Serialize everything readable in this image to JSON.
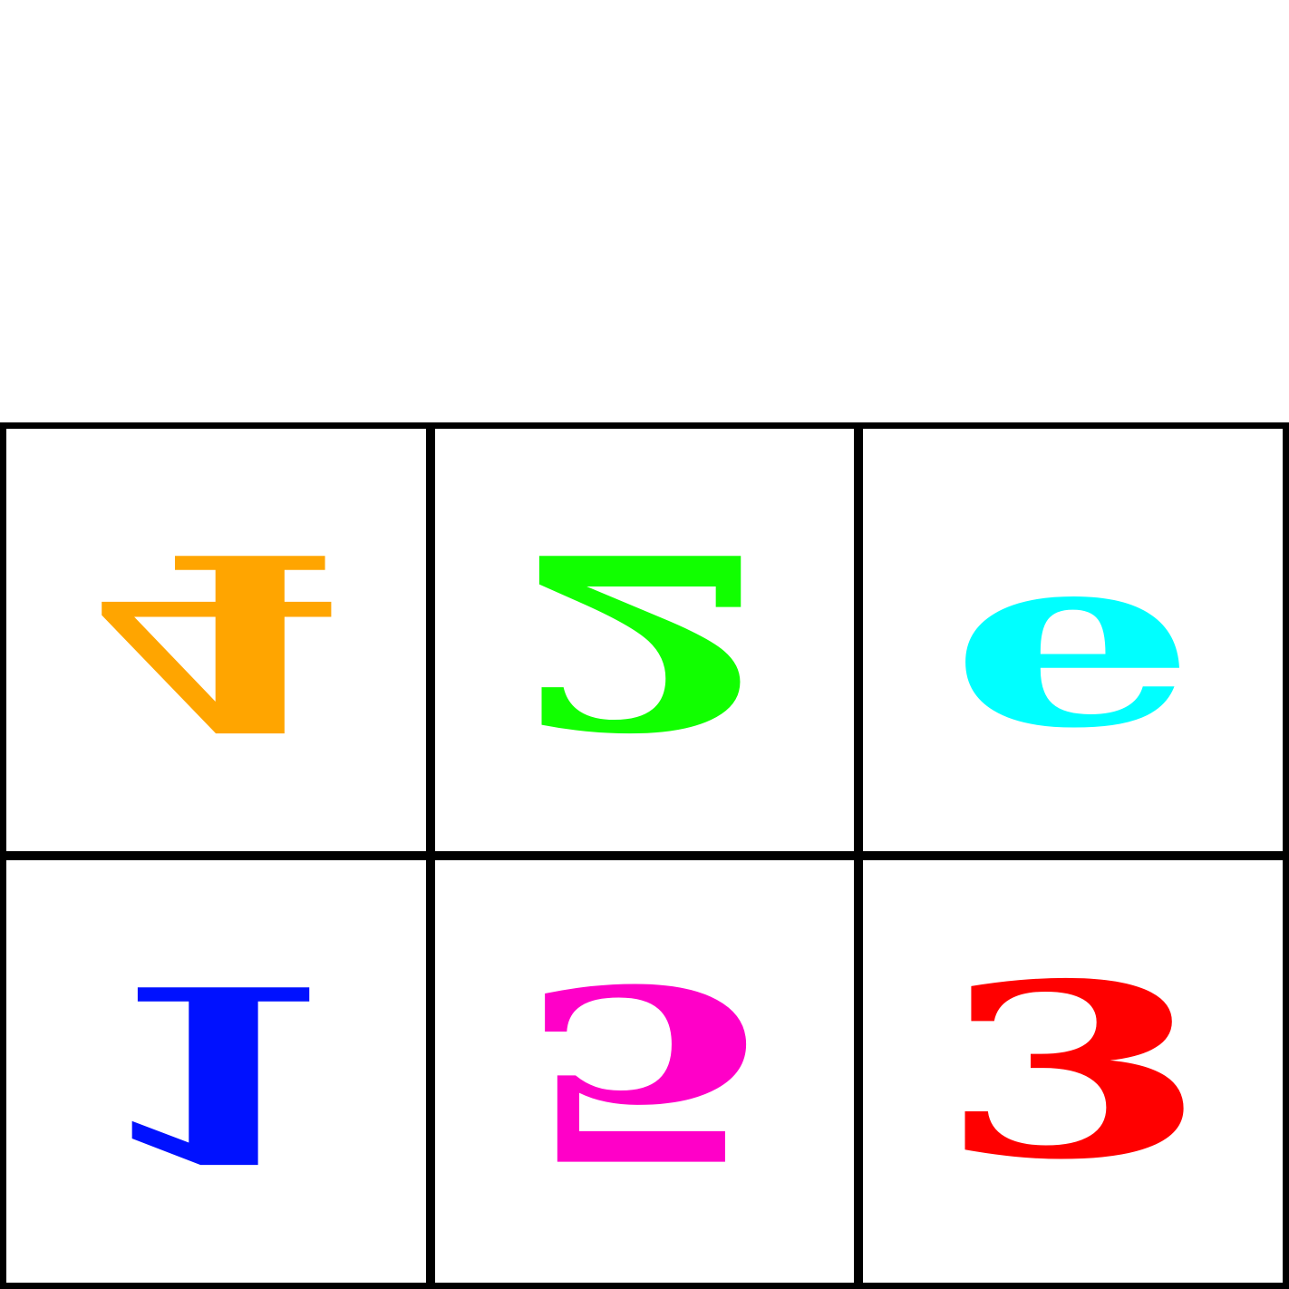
{
  "grid": {
    "cells": [
      {
        "digit": "4",
        "color": "#FFA500",
        "transform": "vertical-flip"
      },
      {
        "digit": "2",
        "color": "#11FF00",
        "transform": "vertical-flip"
      },
      {
        "digit": "e",
        "color": "#00FFFF",
        "transform": "none"
      },
      {
        "digit": "1",
        "color": "#0011FF",
        "transform": "vertical-flip"
      },
      {
        "digit": "5",
        "color": "#FF00C8",
        "transform": "vertical-flip"
      },
      {
        "digit": "3",
        "color": "#FF0000",
        "transform": "none"
      }
    ]
  }
}
